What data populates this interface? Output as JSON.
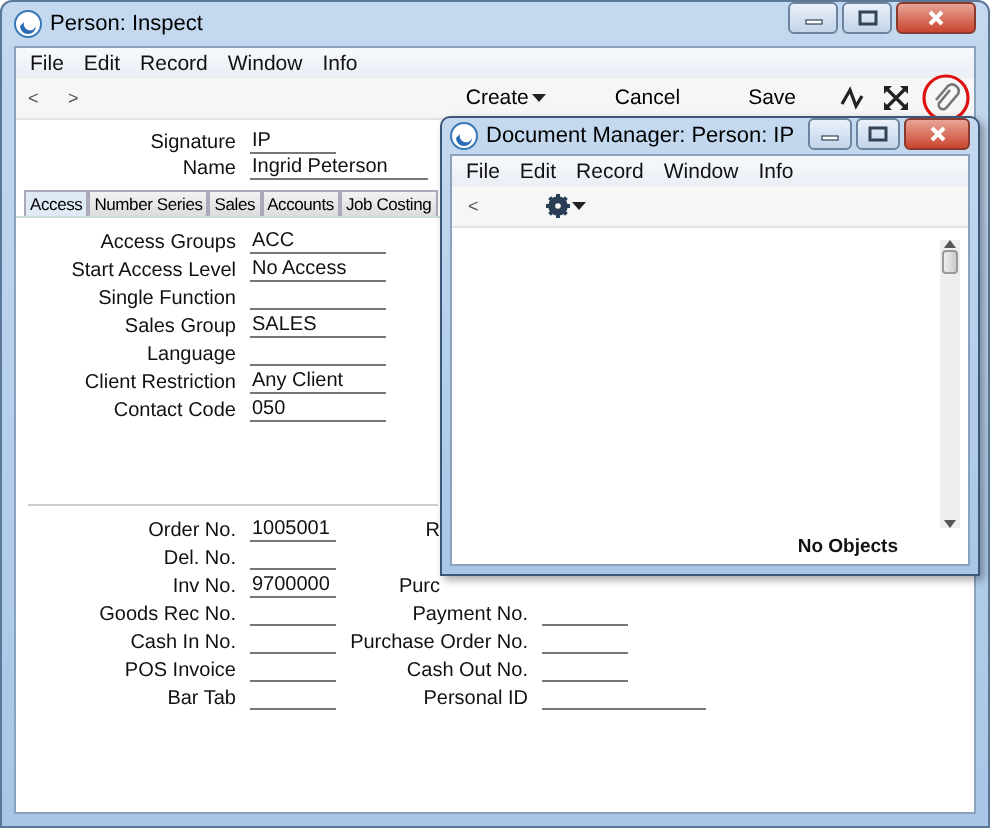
{
  "window": {
    "title": "Person: Inspect"
  },
  "menu": [
    "File",
    "Edit",
    "Record",
    "Window",
    "Info"
  ],
  "toolbar": {
    "nav": [
      "<",
      ">"
    ],
    "buttons": [
      {
        "label": "Create",
        "kind": "dropdown"
      },
      {
        "label": "Cancel",
        "kind": "plain"
      },
      {
        "label": "Save",
        "kind": "plain"
      }
    ]
  },
  "header_fields": [
    {
      "label": "Signature",
      "value": "IP",
      "kind": "short"
    },
    {
      "label": "Name",
      "value": "Ingrid Peterson",
      "kind": "long"
    }
  ],
  "tabs": [
    {
      "label": "Access",
      "selected": true
    },
    {
      "label": "Number Series",
      "selected": false
    },
    {
      "label": "Sales",
      "selected": false
    },
    {
      "label": "Accounts",
      "selected": false
    },
    {
      "label": "Job Costing",
      "selected": false
    }
  ],
  "access_fields": [
    {
      "label": "Access Groups",
      "value": "ACC"
    },
    {
      "label": "Start Access Level",
      "value": "No Access"
    },
    {
      "label": "Single Function"
    },
    {
      "label": "Sales Group",
      "value": "SALES"
    },
    {
      "label": "Language"
    },
    {
      "label": "Client Restriction",
      "value": "Any Client"
    },
    {
      "label": "Contact Code",
      "value": "050"
    }
  ],
  "number_rows": [
    {
      "left": {
        "label": "Order No.",
        "value": "1005001"
      },
      "right": {
        "label": "R",
        "kind": "cut"
      }
    },
    {
      "left": {
        "label": "Del. No."
      }
    },
    {
      "left": {
        "label": "Inv No.",
        "value": "9700000"
      },
      "right": {
        "label": "Purc",
        "kind": "cut"
      }
    },
    {
      "left": {
        "label": "Goods Rec No."
      },
      "right": {
        "label": "Payment No.",
        "kind": "field"
      }
    },
    {
      "left": {
        "label": "Cash In No."
      },
      "right": {
        "label": "Purchase Order No.",
        "kind": "field"
      }
    },
    {
      "left": {
        "label": "POS Invoice"
      },
      "right": {
        "label": "Cash Out No.",
        "kind": "field"
      }
    },
    {
      "left": {
        "label": "Bar Tab"
      },
      "right": {
        "label": "Personal ID",
        "kind": "wide"
      }
    }
  ],
  "document_manager": {
    "title": "Document Manager: Person: IP",
    "menu": [
      "File",
      "Edit",
      "Record",
      "Window",
      "Info"
    ],
    "nav": "<",
    "status": "No Objects"
  }
}
